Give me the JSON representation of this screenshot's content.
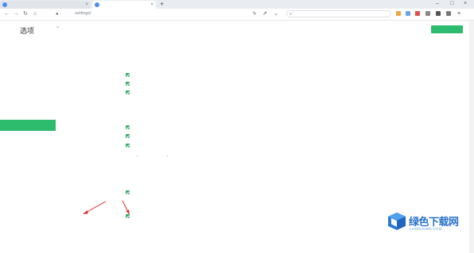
{
  "browser": {
    "tabs": [
      {
        "label": "                ",
        "active": false
      },
      {
        "label": "      ",
        "active": true
      }
    ],
    "new_tab": "+",
    "address": "   settings/",
    "search_placeholder": "           "
  },
  "page": {
    "title": "选项",
    "top_note": "                     ",
    "primary_button": "    "
  },
  "sidebar": {
    "items": [
      {
        "label": "    ",
        "active": false
      },
      {
        "label": "    ",
        "active": false
      },
      {
        "label": "    ",
        "active": false
      },
      {
        "label": "    ",
        "active": false
      },
      {
        "label": "    ",
        "active": false
      },
      {
        "label": "    ",
        "active": false
      },
      {
        "label": "    ",
        "active": false
      },
      {
        "label": "    ",
        "active": true
      },
      {
        "label": "    ",
        "active": false
      }
    ]
  },
  "settings": {
    "top_line": "                           ",
    "section_a_label": "  ",
    "section_a_options": [
      "                 ",
      "                       ",
      "                   "
    ],
    "section_a_note": "                     ",
    "section_b_label": "      ",
    "section_b_options": [
      "          ",
      "         ",
      "              "
    ],
    "section_b_dropdowns": [
      "     ",
      "    "
    ],
    "section_b_button": "    ",
    "section_c_label": "    ",
    "section_c_option": "          ",
    "section_d_label": "    ",
    "section_d_option": "              ",
    "section_e_label": "     ",
    "section_e_value": "                       "
  },
  "watermark": {
    "name": "绿色下载网",
    "url": "LVSEDOWN.COM"
  },
  "colors": {
    "accent": "#2dbb6e",
    "arrow": "#d9302c",
    "checkbox": "#3cb16a"
  }
}
